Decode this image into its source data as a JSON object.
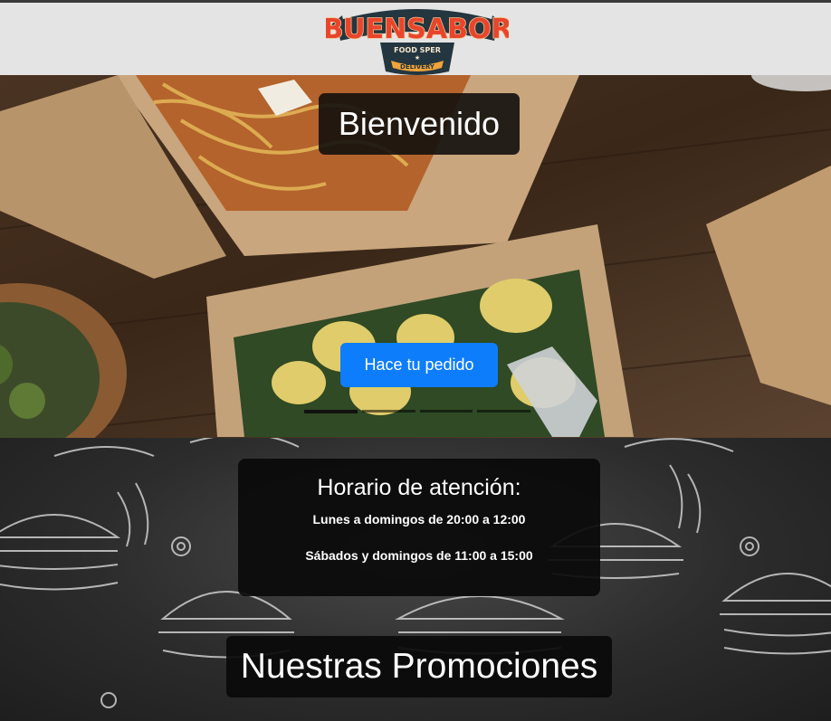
{
  "header": {
    "logo": {
      "brand": "BUENSABOR",
      "tagline": "FOOD SPER",
      "ribbon": "DELIVERY"
    }
  },
  "hero": {
    "title": "Bienvenido",
    "cta_label": "Hace tu pedido",
    "carousel": {
      "slide_count": 4,
      "active_index": 0
    }
  },
  "hours": {
    "title": "Horario de atención:",
    "lines": [
      "Lunes a domingos de 20:00 a 12:00",
      "Sábados y domingos de 11:00 a 15:00"
    ]
  },
  "promotions": {
    "title": "Nuestras Promociones"
  },
  "colors": {
    "header_bg": "#e4e4e4",
    "primary_button": "#0d7dfc",
    "logo_red": "#e8452c",
    "logo_dark": "#24363f",
    "logo_orange": "#f2a33a"
  }
}
